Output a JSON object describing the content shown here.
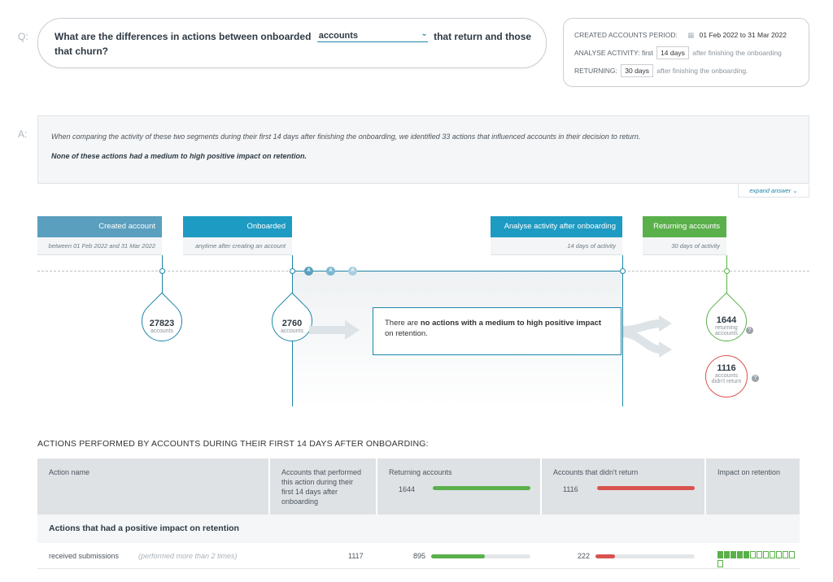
{
  "question": {
    "glyph": "Q:",
    "part1": "What are the differences in actions between onboarded",
    "selected": "accounts",
    "part2": "that return and those",
    "line2": "that churn?"
  },
  "params": {
    "created_label": "CREATED ACCOUNTS PERIOD:",
    "created_value": "01 Feb 2022 to 31 Mar 2022",
    "analyse_label": "ANALYSE ACTIVITY:",
    "analyse_prefix": "first",
    "analyse_value": "14 days",
    "analyse_suffix": "after finishing the onboarding",
    "returning_label": "RETURNING:",
    "returning_value": "30 days",
    "returning_suffix": "after finishing the onboarding."
  },
  "answer": {
    "glyph": "A:",
    "text1": "When comparing the activity of these two segments during their first 14 days after finishing the onboarding, we identified 33 actions that influenced accounts in their decision to return.",
    "text2": "None of these actions had a medium to high positive impact on retention.",
    "expand": "expand answer"
  },
  "timeline": {
    "stages": [
      {
        "title": "Created account",
        "sub": "between 01 Feb 2022 and 31 Mar 2022",
        "color": "#5a9fbe"
      },
      {
        "title": "Onboarded",
        "sub": "anytime after creating an account",
        "color": "#1e9bc2"
      },
      {
        "title": "Analyse activity after onboarding",
        "sub": "14 days of activity",
        "color": "#1e9bc2"
      },
      {
        "title": "Returning accounts",
        "sub": "30 days of activity",
        "color": "#5ab04a"
      }
    ],
    "drops": [
      {
        "num": "27823",
        "sub": "accounts"
      },
      {
        "num": "2760",
        "sub": "accounts"
      },
      {
        "num": "1644",
        "sub": "returning accounts"
      },
      {
        "num": "1116",
        "sub": "accounts didn't return"
      }
    ],
    "mini_labels": [
      "A",
      "A",
      "A"
    ],
    "message_pre": "There are ",
    "message_bold": "no actions with a medium to high positive impact",
    "message_post": "on retention."
  },
  "table": {
    "title": "ACTIONS PERFORMED BY ACCOUNTS DURING THEIR FIRST 14 DAYS AFTER ONBOARDING:",
    "headers": {
      "action": "Action name",
      "performed": "Accounts that performed this action during their first 14 days after onboarding",
      "returning": "Returning accounts",
      "returning_total": "1644",
      "churned": "Accounts that didn't return",
      "churned_total": "1116",
      "impact": "Impact on retention"
    },
    "section": "Actions that had a positive impact on retention",
    "rows": [
      {
        "name": "received submissions",
        "note": "(performed more than 2 times)",
        "performed": "1117",
        "returning": "895",
        "returning_frac": 0.544,
        "churned": "222",
        "churned_frac": 0.199,
        "impact_filled": 5,
        "impact_total": 13
      }
    ]
  },
  "colors": {
    "blue": "#1e86a8",
    "green": "#5ab04a",
    "red": "#d9534f"
  }
}
